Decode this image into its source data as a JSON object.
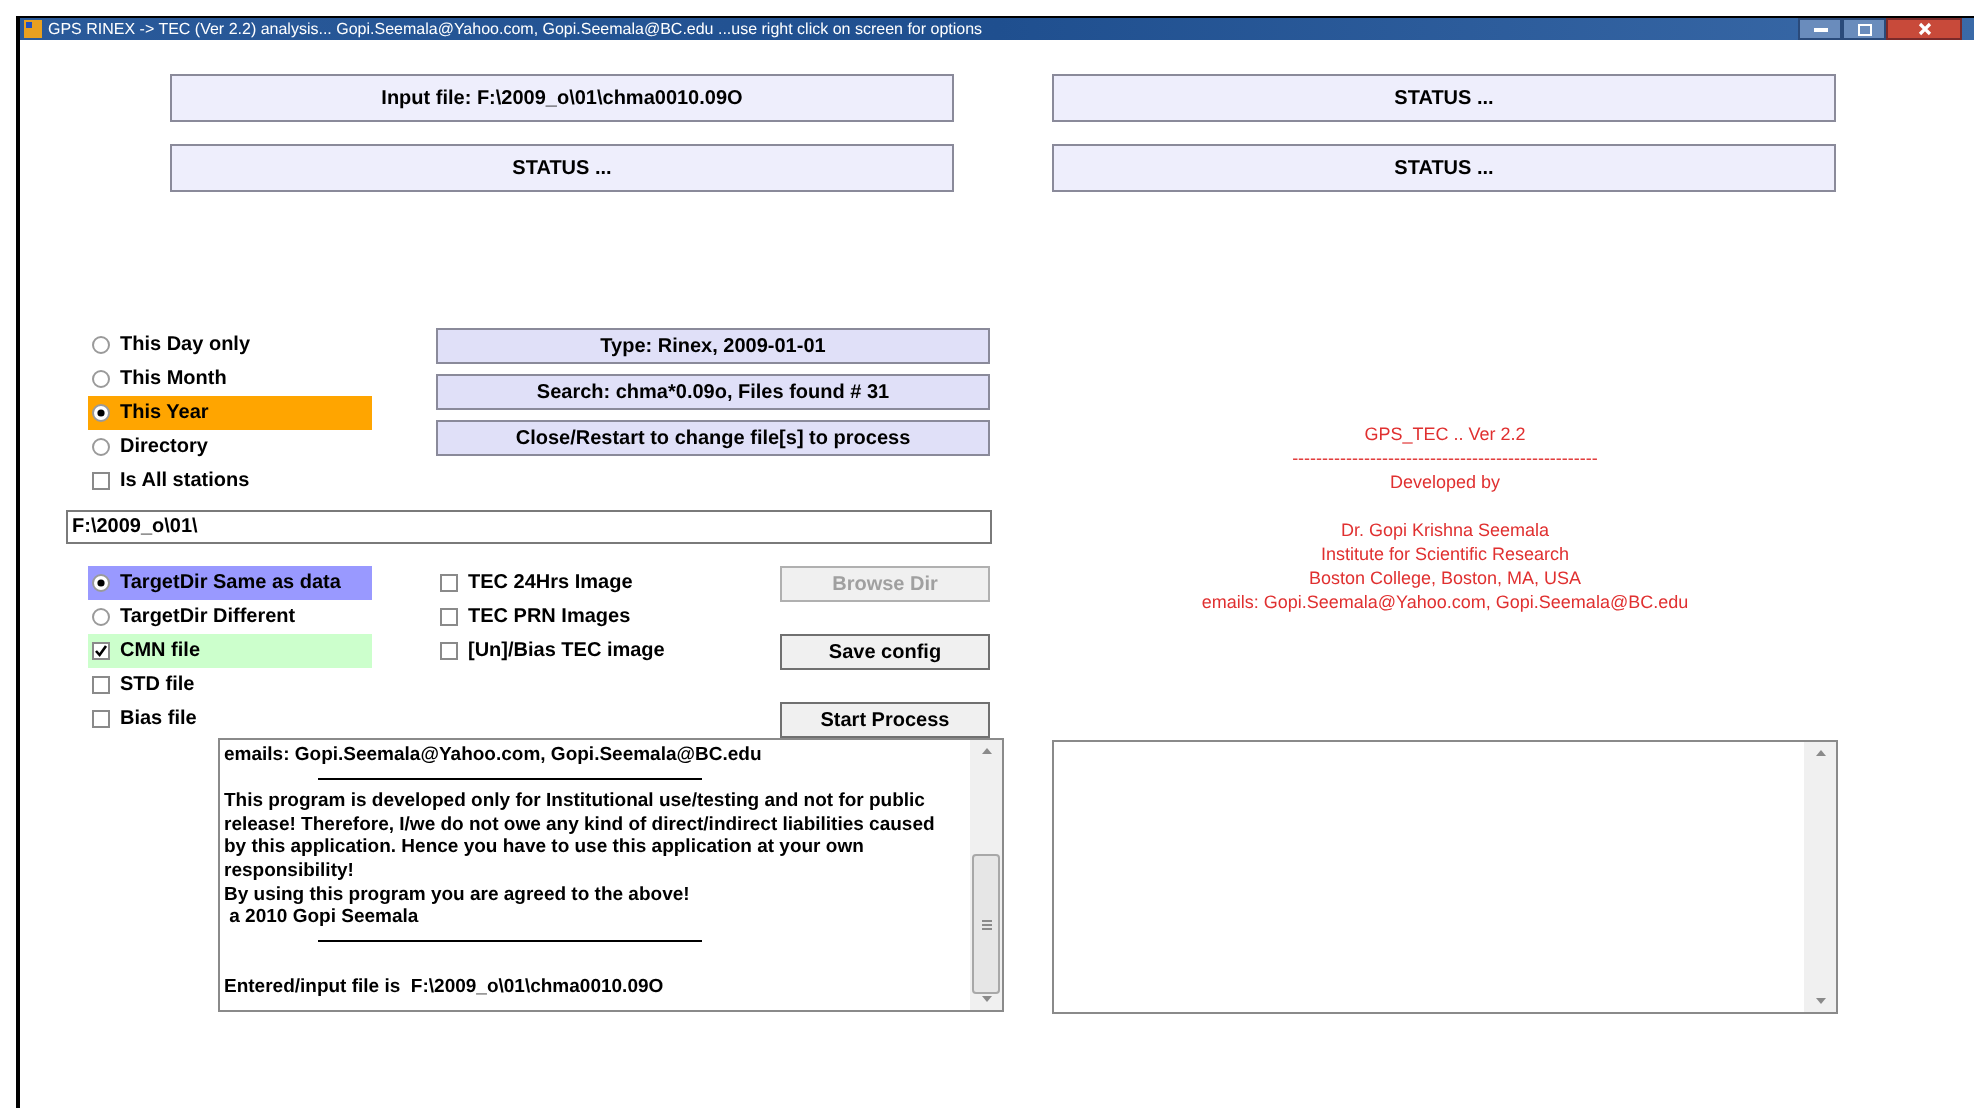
{
  "window": {
    "title": "GPS RINEX -> TEC (Ver 2.2) analysis... Gopi.Seemala@Yahoo.com, Gopi.Seemala@BC.edu ...use right click on screen for options"
  },
  "top_buttons": [
    {
      "label": "Input file: F:\\2009_o\\01\\chma0010.09O"
    },
    {
      "label": "STATUS ..."
    },
    {
      "label": "STATUS ..."
    },
    {
      "label": "STATUS ..."
    }
  ],
  "period_options": [
    {
      "kind": "radio",
      "label": "This Day only",
      "selected": false
    },
    {
      "kind": "radio",
      "label": "This Month",
      "selected": false
    },
    {
      "kind": "radio",
      "label": "This Year",
      "selected": true,
      "color": "#ffa500"
    },
    {
      "kind": "radio",
      "label": "Directory",
      "selected": false
    },
    {
      "kind": "checkbox",
      "label": "Is All stations",
      "checked": false
    }
  ],
  "info_buttons": [
    {
      "label": "Type: Rinex, 2009-01-01"
    },
    {
      "label": "Search: chma*0.09o, Files found # 31"
    },
    {
      "label": "Close/Restart to change file[s] to process"
    }
  ],
  "path_field": {
    "value": "F:\\2009_o\\01\\"
  },
  "output_options": [
    {
      "kind": "radio",
      "label": "TargetDir Same as data",
      "selected": true,
      "color": "#9999ff"
    },
    {
      "kind": "radio",
      "label": "TargetDir Different",
      "selected": false
    },
    {
      "kind": "checkbox",
      "label": "CMN file",
      "checked": true,
      "color": "#ccffcc"
    },
    {
      "kind": "checkbox",
      "label": "STD file",
      "checked": false
    },
    {
      "kind": "checkbox",
      "label": "Bias file",
      "checked": false
    }
  ],
  "image_options": [
    {
      "kind": "checkbox",
      "label": "TEC 24Hrs Image",
      "checked": false
    },
    {
      "kind": "checkbox",
      "label": "TEC PRN Images",
      "checked": false
    },
    {
      "kind": "checkbox",
      "label": "[Un]/Bias TEC image",
      "checked": false
    }
  ],
  "action_buttons": [
    {
      "label": "Browse Dir",
      "disabled": true
    },
    {
      "label": "Save config",
      "disabled": false
    },
    {
      "label": "Start Process",
      "disabled": false
    }
  ],
  "log": {
    "lines": [
      {
        "kind": "text",
        "text": "emails: Gopi.Seemala@Yahoo.com, Gopi.Seemala@BC.edu"
      },
      {
        "kind": "rule"
      },
      {
        "kind": "text",
        "text": "This program is developed only for Institutional use/testing and not for public"
      },
      {
        "kind": "text",
        "text": "release! Therefore, I/we do not owe any kind of direct/indirect liabilities caused"
      },
      {
        "kind": "text",
        "text": "by this application. Hence you have to use this application at your own"
      },
      {
        "kind": "text",
        "text": "responsibility!"
      },
      {
        "kind": "text",
        "text": "By using this program you are agreed to the above!"
      },
      {
        "kind": "text",
        "text": " a 2010 Gopi Seemala"
      },
      {
        "kind": "rule"
      },
      {
        "kind": "blank"
      },
      {
        "kind": "text",
        "text": "Entered/input file is  F:\\2009_o\\01\\chma0010.09O"
      }
    ]
  },
  "about": {
    "lines": [
      {
        "kind": "text",
        "text": "GPS_TEC .. Ver 2.2"
      },
      {
        "kind": "text",
        "text": "---------------------------------------------------"
      },
      {
        "kind": "text",
        "text": "Developed by"
      },
      {
        "kind": "blank"
      },
      {
        "kind": "text",
        "text": "Dr. Gopi Krishna Seemala"
      },
      {
        "kind": "text",
        "text": "Institute for Scientific Research"
      },
      {
        "kind": "text",
        "text": "Boston College, Boston, MA, USA"
      },
      {
        "kind": "text",
        "text": "emails: Gopi.Seemala@Yahoo.com, Gopi.Seemala@BC.edu"
      }
    ]
  }
}
